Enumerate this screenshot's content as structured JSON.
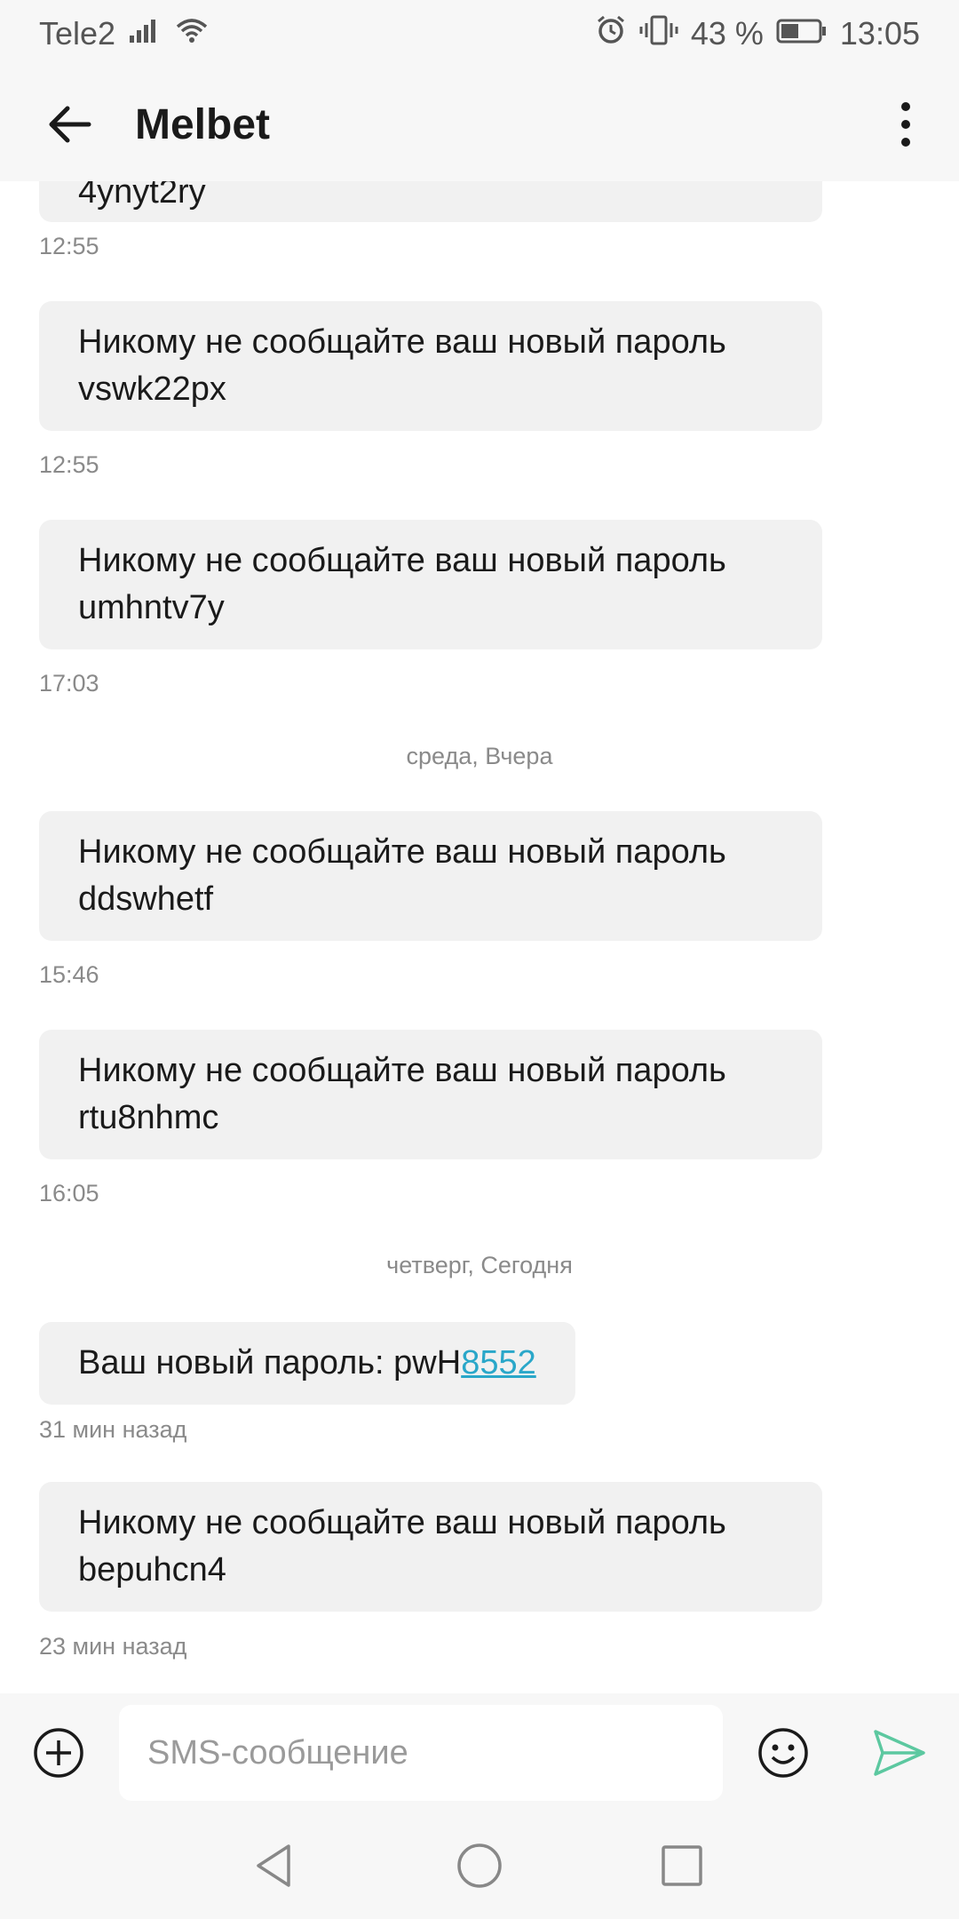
{
  "status_bar": {
    "carrier": "Tele2",
    "battery_percent": "43 %",
    "time": "13:05",
    "icons": [
      "signal-icon",
      "wifi-icon",
      "alarm-icon",
      "vibrate-icon",
      "battery-icon"
    ]
  },
  "header": {
    "title": "Melbet",
    "icons": [
      "back-arrow-icon",
      "more-vert-icon"
    ]
  },
  "messages": [
    {
      "type": "partial",
      "text": "4ynyt2ry",
      "time": "12:55"
    },
    {
      "type": "msg",
      "line1": "Никому не сообщайте ваш новый пароль",
      "line2": "vswk22px",
      "time": "12:55"
    },
    {
      "type": "msg",
      "line1": "Никому не сообщайте ваш новый пароль",
      "line2": "umhntv7y",
      "time": "17:03"
    },
    {
      "type": "date",
      "text": "среда, Вчера"
    },
    {
      "type": "msg",
      "line1": "Никому не сообщайте ваш новый пароль",
      "line2": "ddswhetf",
      "time": "15:46"
    },
    {
      "type": "msg",
      "line1": "Никому не сообщайте ваш новый пароль",
      "line2": "rtu8nhmc",
      "time": "16:05"
    },
    {
      "type": "date",
      "text": "четверг, Сегодня"
    },
    {
      "type": "short",
      "prefix": "Ваш новый пароль: pwH",
      "link": "8552",
      "time": "31 мин назад"
    },
    {
      "type": "msg",
      "line1": "Никому не сообщайте ваш новый пароль",
      "line2": "bepuhcn4",
      "time": "23 мин назад"
    }
  ],
  "composer": {
    "placeholder": "SMS-сообщение",
    "send_color": "#5cc8a0",
    "icons": [
      "add-circle-icon",
      "emoji-icon",
      "send-icon"
    ]
  },
  "nav_bar": {
    "icons": [
      "nav-back-icon",
      "nav-home-icon",
      "nav-recents-icon"
    ]
  }
}
